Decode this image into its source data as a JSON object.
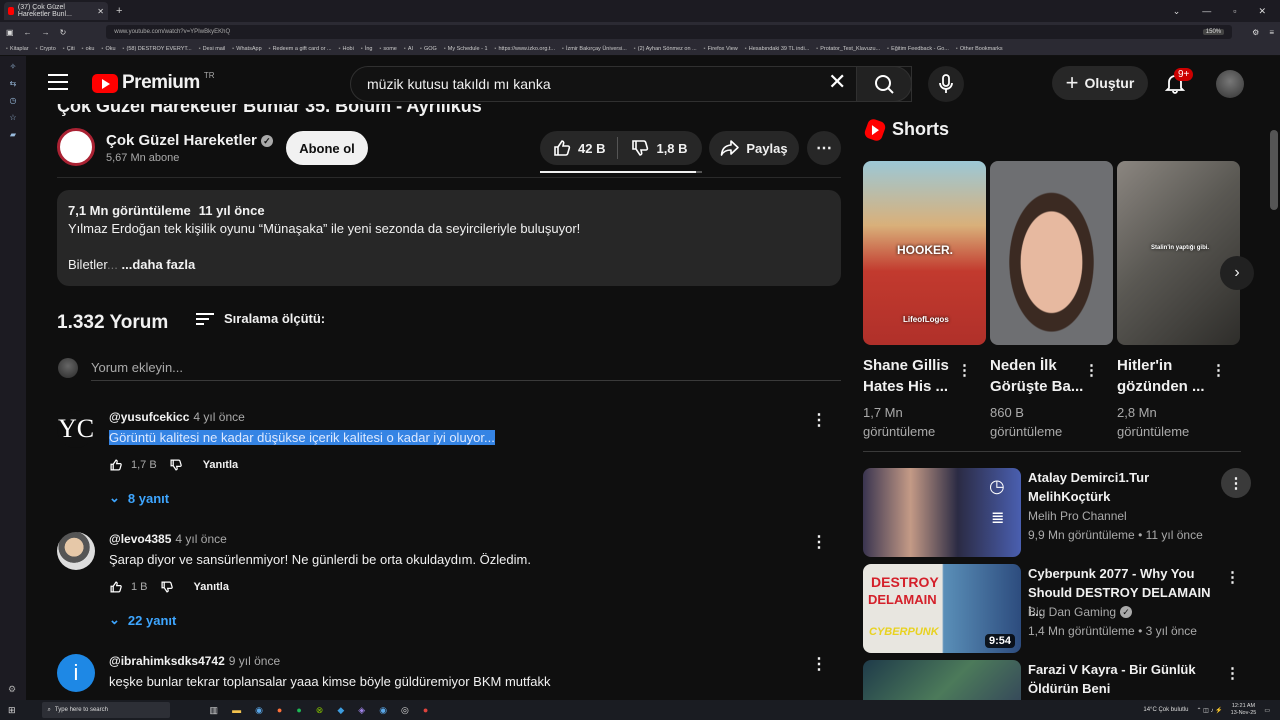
{
  "browser": {
    "tab_title": "(37) Çok Güzel Hareketler Bunl...",
    "url": "www.youtube.com/watch?v=YPIwBkyEKhQ",
    "zoom": "150%",
    "bookmarks": [
      "Kitaplar",
      "Crypto",
      "Çiti",
      "oku",
      "Oku",
      "(58) DESTROY EVERYT...",
      "Desi mail",
      "WhatsApp",
      "Redeem a gift card or ...",
      "Hobi",
      "İng",
      "some",
      "AI",
      "GOG",
      "My Schedule - 1",
      "https://www.izko.org.t...",
      "İzmir Bakırçay Üniversi...",
      "(2) Ayhan Sönmez on ...",
      "Firefox View",
      "Hesabındaki 39 TL indi...",
      "Protator_Test_Klavuzu...",
      "Eğitim Feedback - Go...",
      "Other Bookmarks"
    ]
  },
  "header": {
    "logo_text": "Premium",
    "country_code": "TR",
    "search_value": "müzik kutusu takıldı mı kanka",
    "create_label": "Oluştur",
    "notification_count": "9+"
  },
  "video": {
    "title": "Çok Güzel Hareketler Bunlar 35. Bölüm - Ayrılıkus",
    "channel_name": "Çok Güzel Hareketler",
    "subscribers": "5,67 Mn abone",
    "subscribe_label": "Abone ol",
    "likes": "42 B",
    "dislikes": "1,8 B",
    "like_ratio": 0.96,
    "share_label": "Paylaş",
    "description": {
      "views": "7,1 Mn görüntüleme",
      "age": "11 yıl önce",
      "line1": "Yılmaz Erdoğan tek kişilik oyunu “Münaşaka” ile yeni sezonda da seyircileriyle buluşuyor!",
      "line2_start": "Biletler",
      "line2_fade": "...",
      "more": "...daha fazla"
    }
  },
  "comments_section": {
    "count_label": "1.332 Yorum",
    "sort_label": "Sıralama ölçütü:",
    "add_placeholder": "Yorum ekleyin...",
    "reply_label": "Yanıtla",
    "items": [
      {
        "author": "@yusufcekicc",
        "time": "4 yıl önce",
        "text": "Görüntü kalitesi ne kadar düşükse içerik kalitesi o kadar iyi oluyor...",
        "likes": "1,7 B",
        "replies": "8 yanıt"
      },
      {
        "author": "@levo4385",
        "time": "4 yıl önce",
        "text": "Şarap diyor ve sansürlenmiyor! Ne günlerdi be orta okuldaydım. Özledim.",
        "likes": "1 B",
        "replies": "22 yanıt"
      },
      {
        "author": "@ibrahimksdks4742",
        "time": "9 yıl önce",
        "text": "keşke bunlar tekrar toplansalar yaaa kimse böyle güldüremiyor BKM mutfakk",
        "likes": "",
        "replies": "",
        "avatar_letter": "i"
      }
    ]
  },
  "shorts": {
    "heading": "Shorts",
    "items": [
      {
        "title": "Shane Gillis Hates His ...",
        "views": "1,7 Mn görüntüleme",
        "caption_top": "HOOKER.",
        "caption_bottom": "LifeofLogos"
      },
      {
        "title": "Neden İlk Görüşte Ba...",
        "views": "860 B görüntüleme"
      },
      {
        "title": "Hitler'in gözünden ...",
        "views": "2,8 Mn görüntüleme",
        "caption_top": "Stalin'in yaptığı gibi."
      }
    ]
  },
  "recommendations": [
    {
      "title": "Atalay Demirci1.Tur MelihKoçtürk",
      "channel": "Melih Pro Channel",
      "meta": "9,9 Mn görüntüleme • 11 yıl önce"
    },
    {
      "title": "Cyberpunk 2077 - Why You Should DESTROY DELAMAIN i...",
      "channel": "Big Dan Gaming",
      "meta": "1,4 Mn görüntüleme • 3 yıl önce",
      "duration": "9:54",
      "thumb_text_1": "DESTROY",
      "thumb_text_2": "DELAMAIN",
      "thumb_text_3": "CYBERPUNK"
    },
    {
      "title": "Farazi V Kayra - Bir Günlük Öldürün Beni",
      "channel": "",
      "meta": ""
    }
  ],
  "taskbar": {
    "search_placeholder": "Type here to search",
    "weather": "14°C  Çok bulutlu",
    "time": "12:21 AM",
    "date": "13-Nov-25"
  }
}
